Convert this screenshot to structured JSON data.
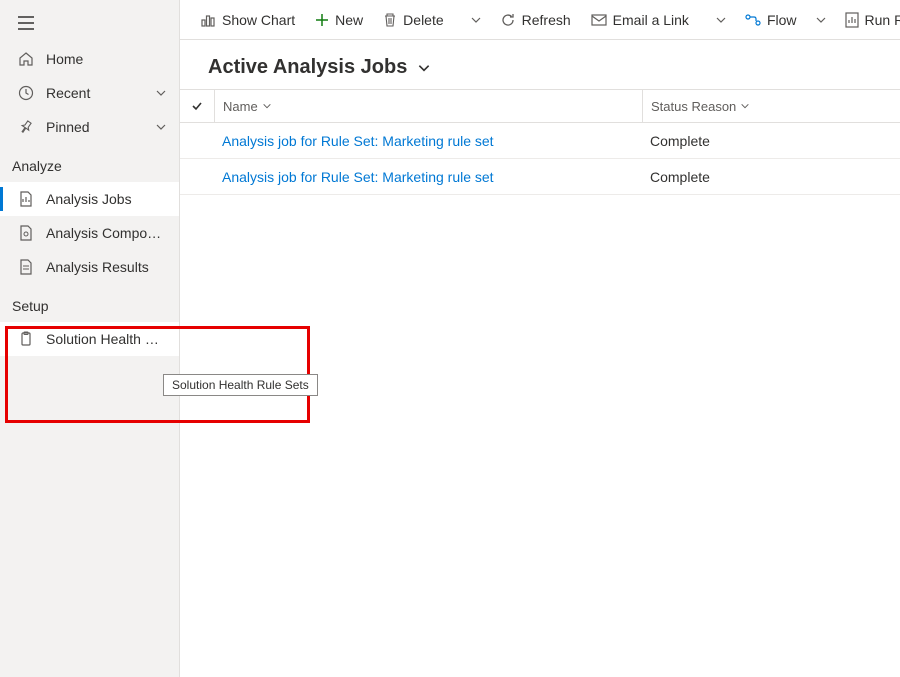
{
  "sidebar": {
    "nav": {
      "home": "Home",
      "recent": "Recent",
      "pinned": "Pinned"
    },
    "sections": {
      "analyze": {
        "header": "Analyze",
        "items": {
          "jobs": "Analysis Jobs",
          "components": "Analysis Components",
          "results": "Analysis Results"
        }
      },
      "setup": {
        "header": "Setup",
        "items": {
          "solution_health": "Solution Health Rule ..."
        }
      }
    },
    "tooltip": "Solution Health Rule Sets"
  },
  "toolbar": {
    "show_chart": "Show Chart",
    "new": "New",
    "delete": "Delete",
    "refresh": "Refresh",
    "email_link": "Email a Link",
    "flow": "Flow",
    "run_report": "Run Report"
  },
  "view": {
    "title": "Active Analysis Jobs"
  },
  "table": {
    "columns": {
      "name": "Name",
      "status": "Status Reason"
    },
    "rows": [
      {
        "name": "Analysis job for Rule Set: Marketing rule set",
        "status": "Complete"
      },
      {
        "name": "Analysis job for Rule Set: Marketing rule set",
        "status": "Complete"
      }
    ]
  }
}
